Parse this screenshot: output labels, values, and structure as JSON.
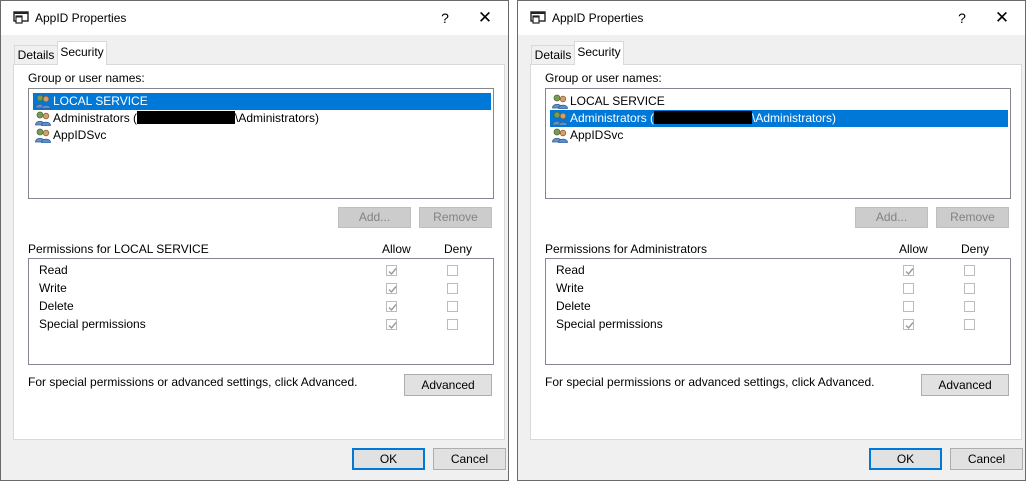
{
  "dialogs": [
    {
      "title": "AppID Properties",
      "help_label": "?",
      "close_label": "✕",
      "tabs": [
        {
          "label": "Details"
        },
        {
          "label": "Security"
        }
      ],
      "group_label": "Group or user names:",
      "users": [
        {
          "prefix": "LOCAL SERVICE",
          "suffix": "",
          "redacted": false
        },
        {
          "prefix": "Administrators (",
          "suffix": "\\Administrators)",
          "redacted": true
        },
        {
          "prefix": "AppIDSvc",
          "suffix": "",
          "redacted": false
        }
      ],
      "selected_user": 0,
      "add_label": "Add...",
      "remove_label": "Remove",
      "permissions_label": "Permissions for LOCAL SERVICE",
      "allow_label": "Allow",
      "deny_label": "Deny",
      "permissions": [
        {
          "name": "Read",
          "allow": true,
          "deny": false
        },
        {
          "name": "Write",
          "allow": true,
          "deny": false
        },
        {
          "name": "Delete",
          "allow": true,
          "deny": false
        },
        {
          "name": "Special permissions",
          "allow": true,
          "deny": false
        }
      ],
      "advanced_hint": "For special permissions or advanced settings, click Advanced.",
      "advanced_label": "Advanced",
      "ok_label": "OK",
      "cancel_label": "Cancel"
    },
    {
      "title": "AppID Properties",
      "help_label": "?",
      "close_label": "✕",
      "tabs": [
        {
          "label": "Details"
        },
        {
          "label": "Security"
        }
      ],
      "group_label": "Group or user names:",
      "users": [
        {
          "prefix": "LOCAL SERVICE",
          "suffix": "",
          "redacted": false
        },
        {
          "prefix": "Administrators (",
          "suffix": "\\Administrators)",
          "redacted": true
        },
        {
          "prefix": "AppIDSvc",
          "suffix": "",
          "redacted": false
        }
      ],
      "selected_user": 1,
      "add_label": "Add...",
      "remove_label": "Remove",
      "permissions_label": "Permissions for Administrators",
      "allow_label": "Allow",
      "deny_label": "Deny",
      "permissions": [
        {
          "name": "Read",
          "allow": true,
          "deny": false
        },
        {
          "name": "Write",
          "allow": false,
          "deny": false
        },
        {
          "name": "Delete",
          "allow": false,
          "deny": false
        },
        {
          "name": "Special permissions",
          "allow": true,
          "deny": false
        }
      ],
      "advanced_hint": "For special permissions or advanced settings, click Advanced.",
      "advanced_label": "Advanced",
      "ok_label": "OK",
      "cancel_label": "Cancel"
    }
  ],
  "colors": {
    "selection": "#0078d7",
    "dialog_bg": "#f0f0f0",
    "disabled_text": "#838383"
  }
}
